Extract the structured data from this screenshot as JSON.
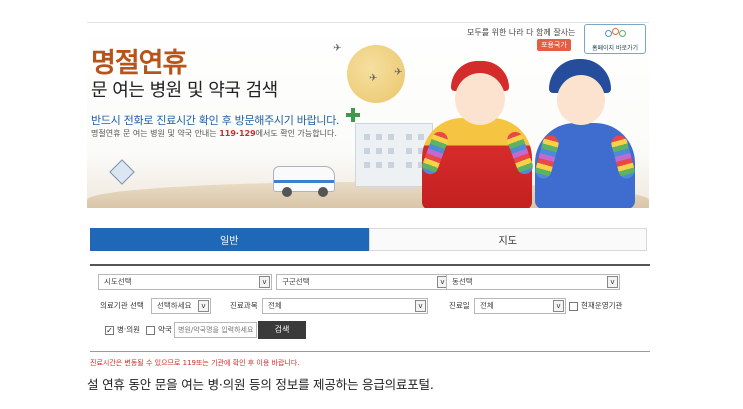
{
  "banner": {
    "slogan": "모두를 위한 나라 다 함께 잘사는",
    "slogan_badge": "포용국가",
    "gov_logo_label": "홈페이지 바로가기",
    "title": "명절연휴",
    "subtitle": "문 여는 병원 및 약국 검색",
    "notice": "반드시 전화로 진료시간 확인 후 방문해주시기 바랍니다.",
    "notice_sub_before": "명절연휴 문 여는 병원 및 약국 안내는 ",
    "notice_sub_em": "119·129",
    "notice_sub_after": "에서도 확인 가능합니다."
  },
  "tabs": [
    {
      "label": "일반",
      "active": true
    },
    {
      "label": "지도",
      "active": false
    }
  ],
  "search": {
    "region_select": "시도선택",
    "district_select": "구군선택",
    "town_select": "동선택",
    "facility_type_label": "의료기관 선택",
    "facility_type_value": "선택하세요",
    "department_label": "진료과목",
    "department_value": "전체",
    "day_label": "진료일",
    "day_value": "전체",
    "open_now_label": "현재운영기관",
    "open_now_checked": false,
    "hospital_label": "병·의원",
    "hospital_checked": true,
    "pharmacy_label": "약국",
    "pharmacy_checked": false,
    "keyword_placeholder": "병원/약국명을 입력하세요",
    "search_button": "검색",
    "dropdown_arrow": "v"
  },
  "warning": "진료시간은 변동될 수 있으므로 119또는 기관에 확인 후 이용 바랍니다.",
  "caption": "설 연휴 동안 문을 여는 병·의원 등의 정보를 제공하는 응급의료포털.",
  "colors": {
    "accent": "#1f68b7",
    "title": "#b8541a",
    "warning": "#d12c2c",
    "button": "#3a3a3a"
  }
}
